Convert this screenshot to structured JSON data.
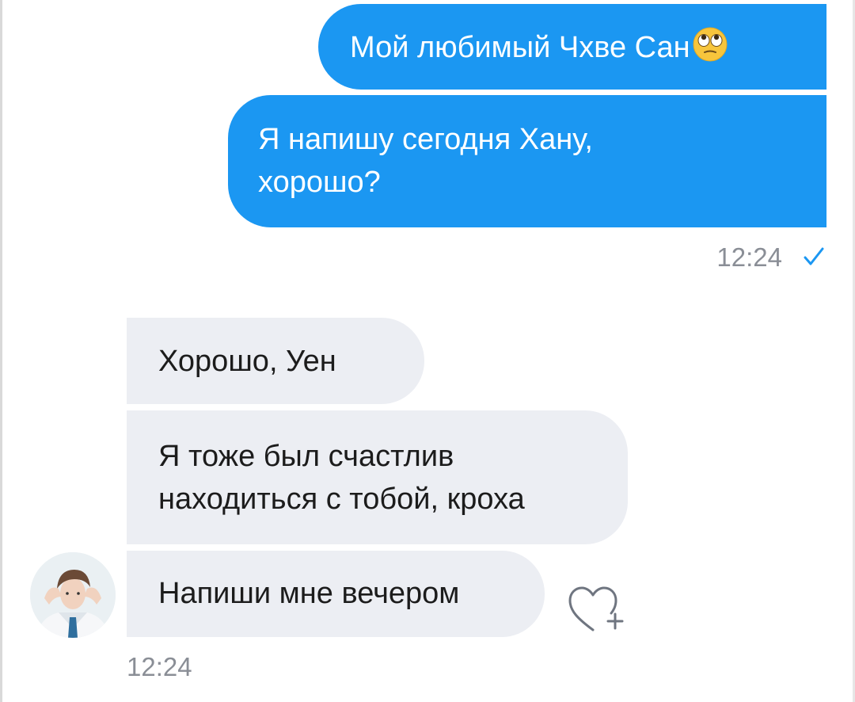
{
  "messages_out": [
    {
      "text": "Мой любимый Чхве Сан",
      "emoji": "face-with-rolling-eyes"
    },
    {
      "line1": "Я напишу сегодня Хану,",
      "line2": "хорошо?"
    }
  ],
  "out_time": "12:24",
  "messages_in": [
    {
      "text": "Хорошо, Уен"
    },
    {
      "line1": "Я тоже был счастлив",
      "line2": "находиться с тобой, кроха"
    },
    {
      "text": "Напиши мне вечером"
    }
  ],
  "in_time": "12:24",
  "colors": {
    "outgoing": "#1b97f2",
    "incoming": "#eceef3",
    "time": "#8a8e96"
  }
}
